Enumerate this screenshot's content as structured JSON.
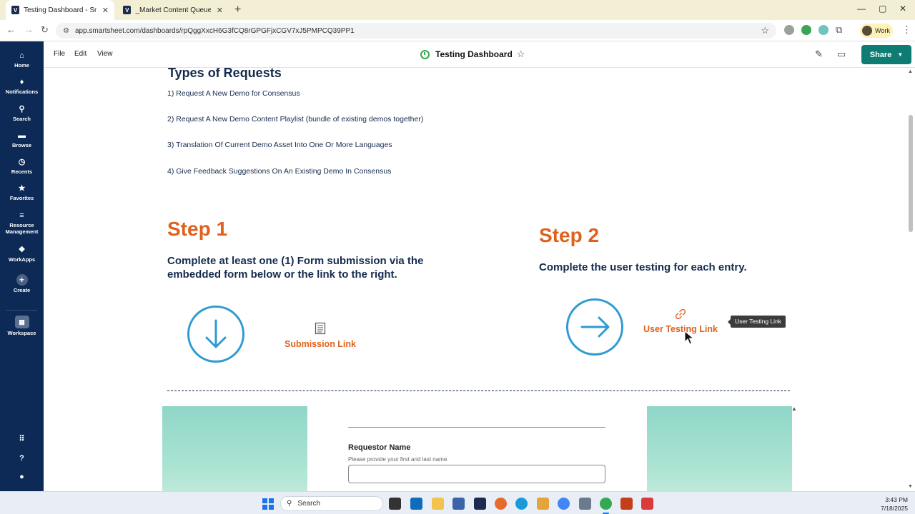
{
  "browser": {
    "tabs": [
      {
        "title": "Testing Dashboard - Smartshee",
        "favicon": "V",
        "active": true
      },
      {
        "title": "_Market Content Queue - NA C",
        "favicon": "V",
        "active": false
      }
    ],
    "url": "app.smartsheet.com/dashboards/rpQggXxcH6G3fCQ8rGPGFjxCGV7xJ5PMPCQ39PP1",
    "profile_label": "Work"
  },
  "leftnav": {
    "items": [
      {
        "label": "Home",
        "icon": "home-icon"
      },
      {
        "label": "Notifications",
        "icon": "bell-icon"
      },
      {
        "label": "Search",
        "icon": "search-icon"
      },
      {
        "label": "Browse",
        "icon": "folder-icon"
      },
      {
        "label": "Recents",
        "icon": "clock-icon"
      },
      {
        "label": "Favorites",
        "icon": "star-icon"
      },
      {
        "label": "Resource Management",
        "icon": "resource-icon"
      },
      {
        "label": "WorkApps",
        "icon": "workapps-icon"
      },
      {
        "label": "Create",
        "icon": "plus-icon"
      },
      {
        "label": "Workspace",
        "icon": "workspace-icon"
      }
    ]
  },
  "header": {
    "menu": [
      "File",
      "Edit",
      "View"
    ],
    "title": "Testing Dashboard",
    "share_label": "Share"
  },
  "content": {
    "types_heading": "Types of Requests",
    "requests": [
      "1) Request A New Demo for Consensus",
      "2) Request A New Demo Content Playlist (bundle of existing demos together)",
      "3) Translation Of Current Demo Asset Into One Or More Languages",
      "4) Give Feedback Suggestions On An Existing Demo In Consensus"
    ],
    "step1": {
      "title": "Step 1",
      "desc": "Complete at least one (1) Form submission via the embedded form below or the link to the right.",
      "link_label": "Submission Link"
    },
    "step2": {
      "title": "Step 2",
      "desc": "Complete the user testing for each entry.",
      "link_label": "User Testing Link",
      "tooltip": "User Testing Link"
    },
    "form": {
      "field_label": "Requestor Name",
      "field_help": "Please provide your first and last name."
    }
  },
  "taskbar": {
    "search_placeholder": "Search",
    "time": "3:43 PM",
    "date": "7/18/2025"
  },
  "colors": {
    "nav_bg": "#0d2a56",
    "accent_orange": "#e0601c",
    "accent_blue": "#2f9bd2",
    "share_green": "#0e7c72",
    "text_navy": "#152b4e"
  }
}
